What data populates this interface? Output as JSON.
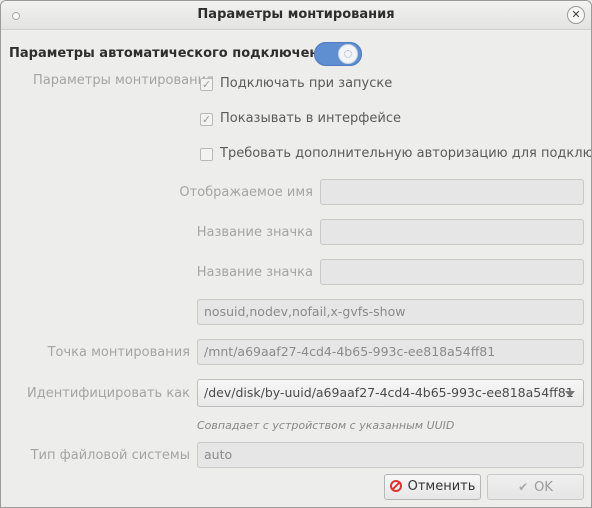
{
  "window": {
    "title": "Параметры монтирования",
    "close_glyph": "✕"
  },
  "automount": {
    "section_title": "Параметры автоматического подключения",
    "switch_on": true,
    "accent_color": "#5f8fd0"
  },
  "mount_options": {
    "group_label": "Параметры монтирования",
    "checkboxes": [
      {
        "label": "Подключать при запуске",
        "checked": true,
        "glyph": "✓"
      },
      {
        "label": "Показывать в интерфейсе",
        "checked": true,
        "glyph": "✓"
      },
      {
        "label": "Требовать дополнительную авторизацию для подключения",
        "checked": false,
        "glyph": ""
      }
    ],
    "display_name": {
      "label": "Отображаемое имя",
      "value": ""
    },
    "icon_name": {
      "label": "Название значка",
      "value": ""
    },
    "symbolic_icon_name": {
      "label": "Название значка",
      "value": ""
    },
    "options_string": "nosuid,nodev,nofail,x-gvfs-show",
    "mount_point": {
      "label": "Точка монтирования",
      "value": "/mnt/a69aaf27-4cd4-4b65-993c-ee818a54ff81"
    },
    "identify_as": {
      "label": "Идентифицировать как",
      "selected": "/dev/disk/by-uuid/a69aaf27-4cd4-4b65-993c-ee818a54ff81",
      "hint": "Совпадает с устройством с указанным UUID"
    },
    "filesystem_type": {
      "label": "Тип файловой системы",
      "value": "auto"
    }
  },
  "buttons": {
    "cancel_label": "Отменить",
    "ok_label": "OK",
    "ok_glyph": "✔"
  }
}
